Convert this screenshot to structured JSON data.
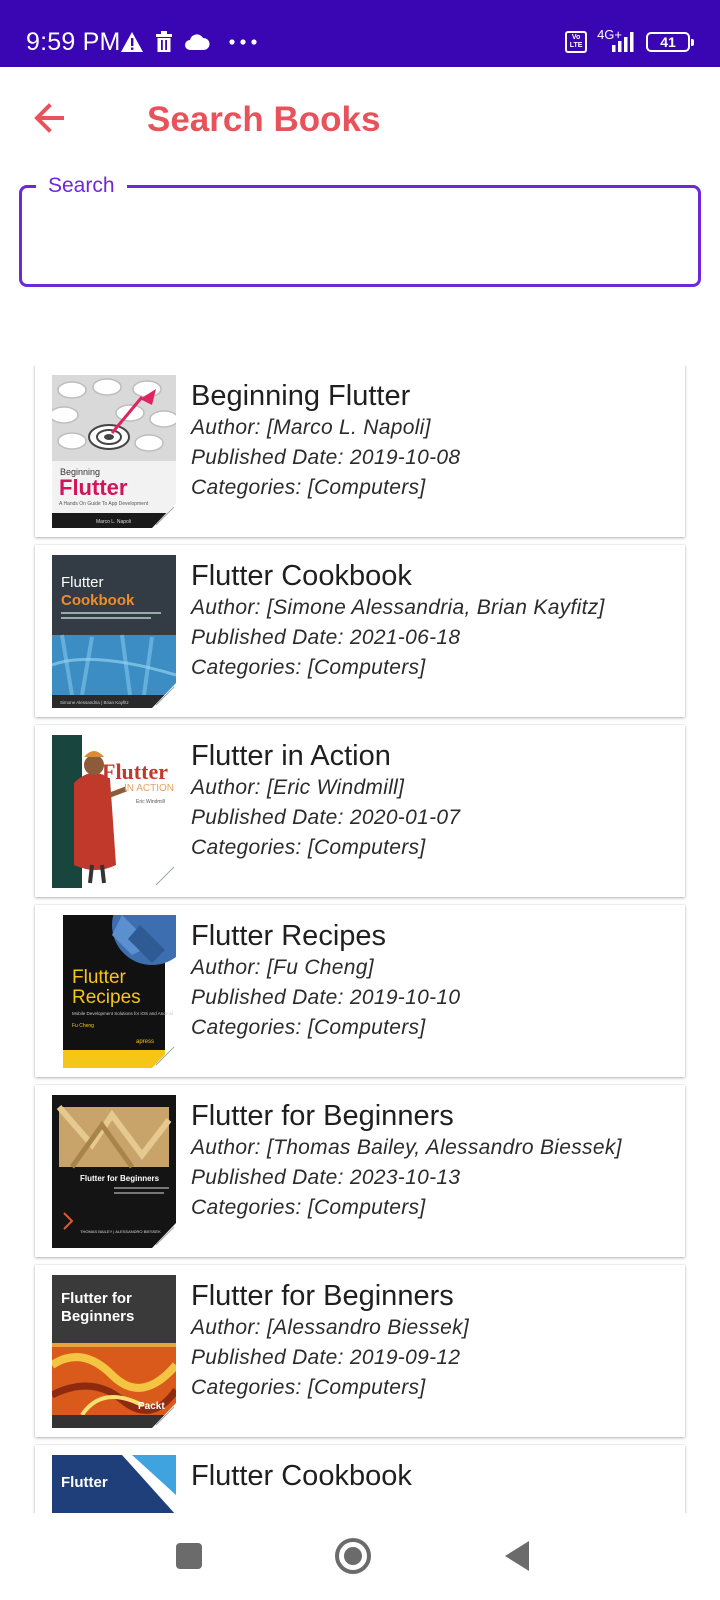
{
  "status_bar": {
    "time": "9:59 PM",
    "left_icons": [
      "warning-icon",
      "delete-icon",
      "cloud-icon",
      "more-dots-icon"
    ],
    "volte": "Vo LTE",
    "network": "4G+",
    "battery": "41"
  },
  "app_bar": {
    "title": "Search Books",
    "back_icon": "arrow-back-icon",
    "accent_color": "#e8535b"
  },
  "search": {
    "label": "Search",
    "value": "",
    "border_color": "#6d28d9"
  },
  "books": [
    {
      "title": "Beginning Flutter",
      "author": "Author: [Marco L. Napoli]",
      "published": "Published Date: 2019-10-08",
      "categories": "Categories: [Computers]",
      "cover_line1": "Beginning",
      "cover_line2": "Flutter",
      "cover_line3": "A Hands On Guide To App Development",
      "cover_line4": "Marco L. Napoli"
    },
    {
      "title": "Flutter Cookbook",
      "author": "Author: [Simone Alessandria, Brian Kayfitz]",
      "published": "Published Date: 2021-06-18",
      "categories": "Categories: [Computers]",
      "cover_line1": "Flutter",
      "cover_line2": "Cookbook",
      "cover_line3": "Simone Alessandria | Brian Kayfitz"
    },
    {
      "title": "Flutter in Action",
      "author": "Author: [Eric Windmill]",
      "published": "Published Date: 2020-01-07",
      "categories": "Categories: [Computers]",
      "cover_line1": "Flutter",
      "cover_line2": "IN ACTION",
      "cover_line3": "Eric Windmill"
    },
    {
      "title": "Flutter Recipes",
      "author": "Author: [Fu Cheng]",
      "published": "Published Date: 2019-10-10",
      "categories": "Categories: [Computers]",
      "cover_line1": "Flutter",
      "cover_line2": "Recipes",
      "cover_line3": "Mobile Development Solutions for iOS and Android",
      "cover_line4": "Fu Cheng",
      "cover_line5": "apress"
    },
    {
      "title": "Flutter for Beginners",
      "author": "Author: [Thomas Bailey, Alessandro Biessek]",
      "published": "Published Date: 2023-10-13",
      "categories": "Categories: [Computers]",
      "cover_line1": "Flutter for Beginners",
      "cover_line2": "THOMAS BAILEY | ALESSANDRO BIESSEK"
    },
    {
      "title": "Flutter for Beginners",
      "author": "Author: [Alessandro Biessek]",
      "published": "Published Date: 2019-09-12",
      "categories": "Categories: [Computers]",
      "cover_line1": "Flutter for",
      "cover_line2": "Beginners",
      "cover_line3": "Packt"
    },
    {
      "title": "Flutter Cookbook",
      "author": "",
      "published": "",
      "categories": "",
      "cover_line1": "Flutter"
    }
  ],
  "nav_bar": {
    "icons": [
      "recents-square-icon",
      "home-circle-icon",
      "back-triangle-icon"
    ]
  }
}
